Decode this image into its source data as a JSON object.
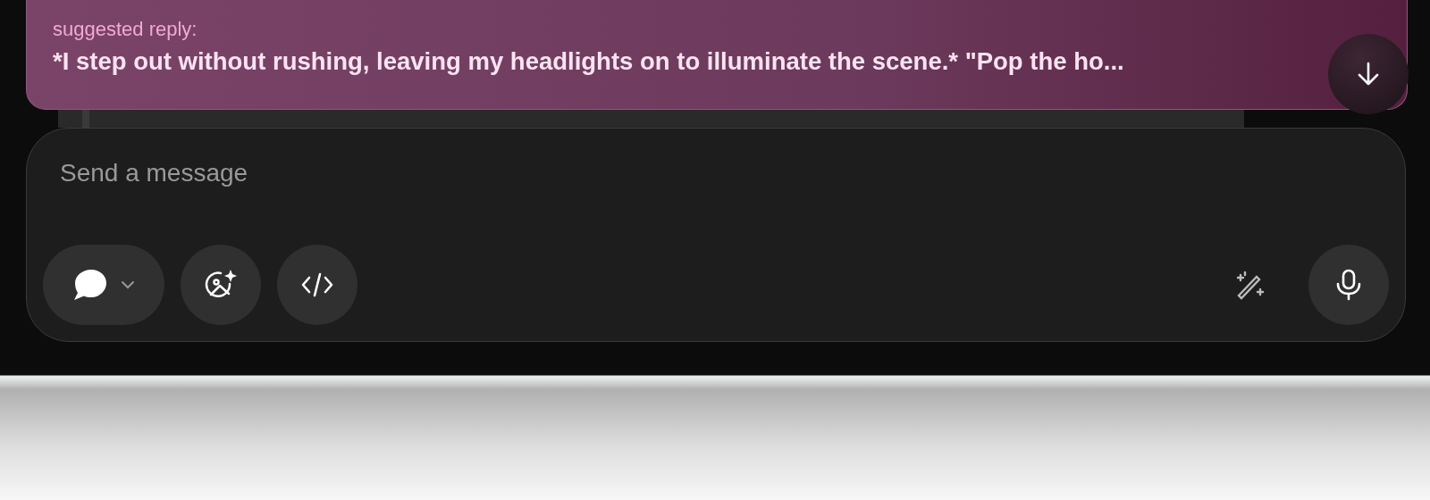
{
  "suggestion": {
    "label": "suggested reply:",
    "text": "*I step out without rushing, leaving my headlights on to illuminate the scene.* \"Pop the ho..."
  },
  "composer": {
    "placeholder": "Send a message"
  }
}
